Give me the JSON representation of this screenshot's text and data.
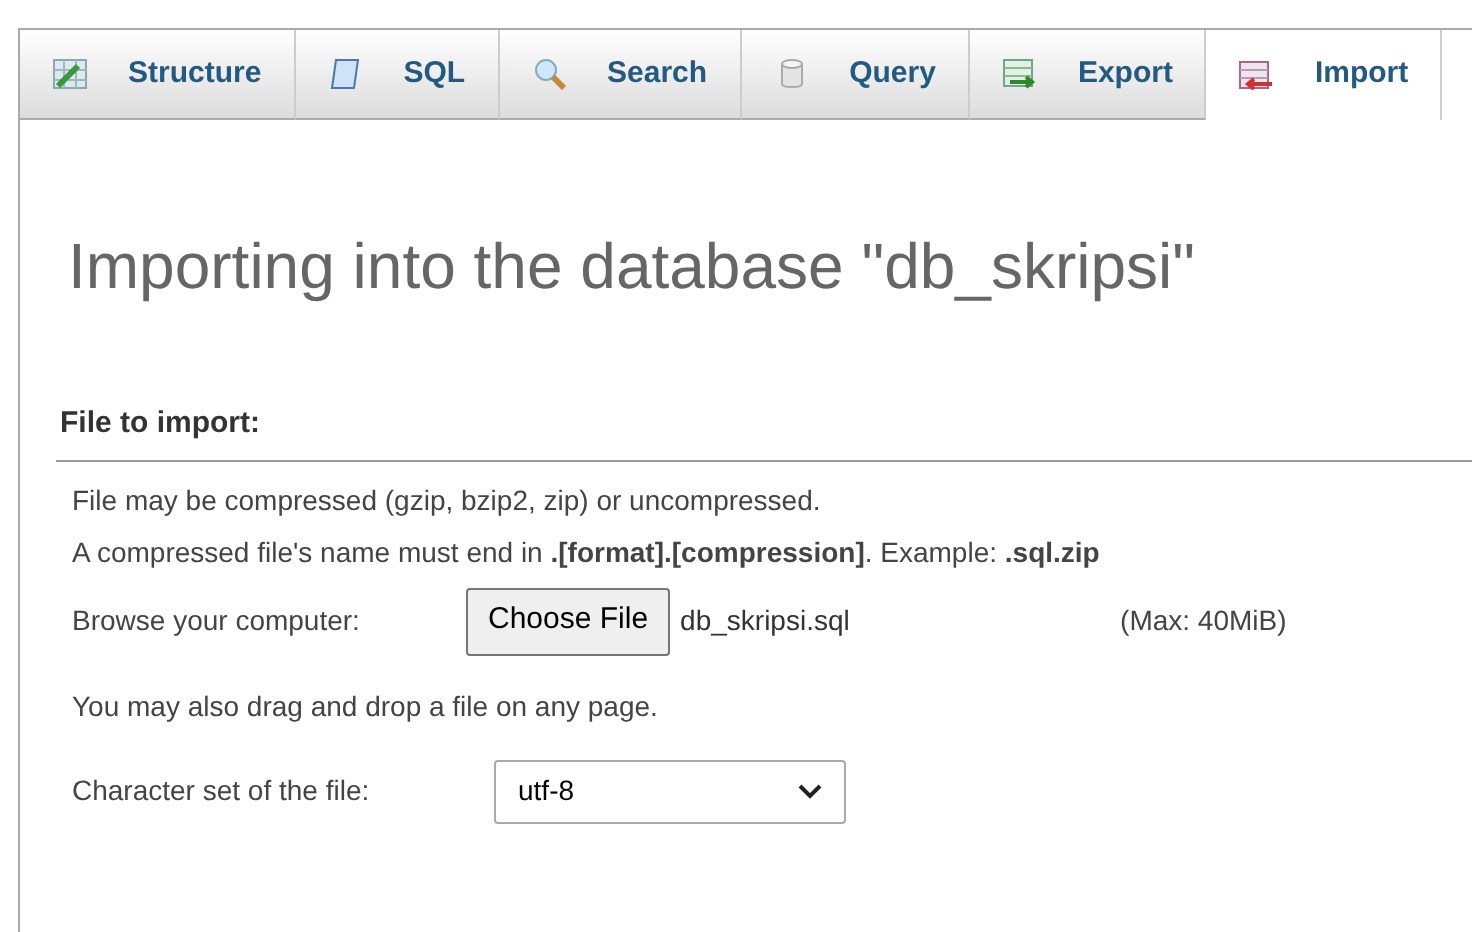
{
  "tabs": [
    {
      "label": "Structure",
      "kind": "structure",
      "selected": false
    },
    {
      "label": "SQL",
      "kind": "sql",
      "selected": false
    },
    {
      "label": "Search",
      "kind": "search",
      "selected": false
    },
    {
      "label": "Query",
      "kind": "query",
      "selected": false
    },
    {
      "label": "Export",
      "kind": "export",
      "selected": false
    },
    {
      "label": "Import",
      "kind": "import",
      "selected": true
    }
  ],
  "heading": "Importing into the database \"db_skripsi\"",
  "section": {
    "title": "File to import:",
    "notes": [
      "File may be compressed (gzip, bzip2, zip) or uncompressed.",
      "A compressed file's name must end in **.[format].[compression]**. Example: **.sql.zip**"
    ],
    "browse_label": "Browse your computer:",
    "choose_button": "Choose File",
    "file_name": "db_skripsi.sql",
    "max_size": "(Max: 40MiB)",
    "drag_note": "You may also drag and drop a file on any page.",
    "charset_label": "Character set of the file:",
    "charset_value": "utf-8"
  }
}
